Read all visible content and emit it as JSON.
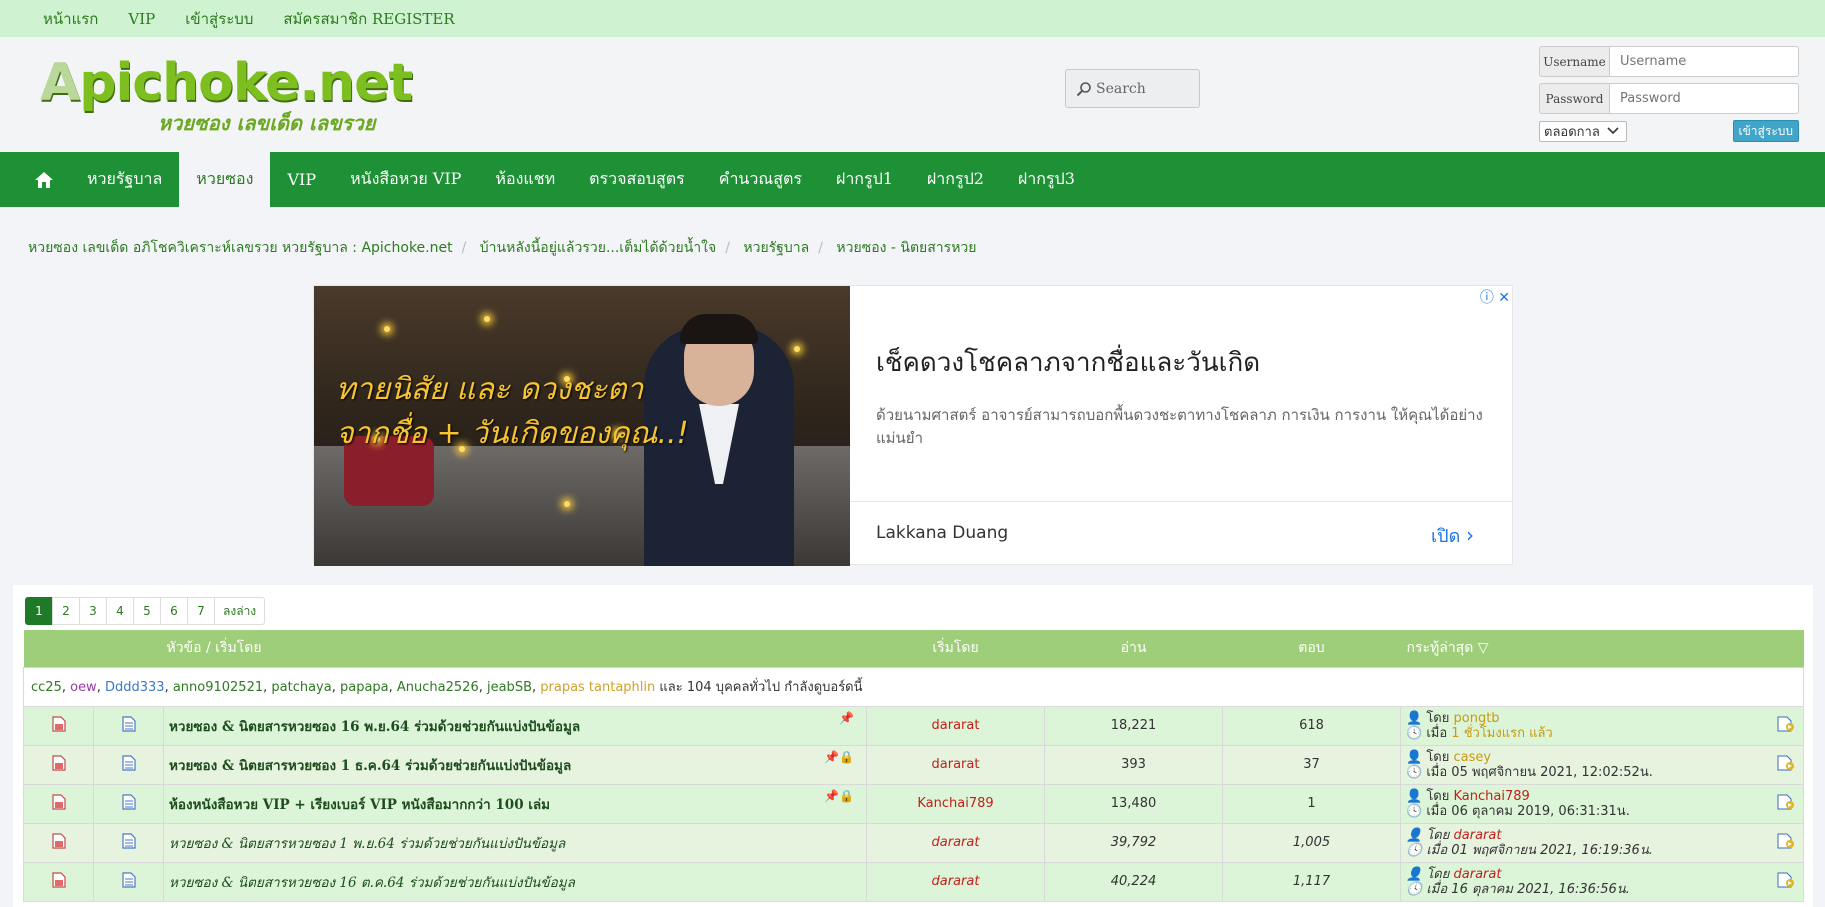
{
  "topbar": {
    "items": [
      "หน้าแรก",
      "VIP",
      "เข้าสู่ระบบ",
      "สมัครสมาชิก REGISTER"
    ]
  },
  "logo": {
    "main_a": "A",
    "main_rest": "pichoke.net",
    "sub": "หวยซอง เลขเด็ด เลขรวย"
  },
  "search": {
    "placeholder": "Search"
  },
  "login": {
    "username_label": "Username",
    "username_placeholder": "Username",
    "password_label": "Password",
    "password_placeholder": "Password",
    "period": "ตลอดกาล",
    "submit": "เข้าสู่ระบบ"
  },
  "nav": {
    "items": [
      "หวยรัฐบาล",
      "หวยซอง",
      "VIP",
      "หนังสือหวย VIP",
      "ห้องแชท",
      "ตรวจสอบสูตร",
      "คำนวณสูตร",
      "ฝากรูป1",
      "ฝากรูป2",
      "ฝากรูป3"
    ],
    "active": "หวยซอง"
  },
  "breadcrumb": [
    "หวยซอง เลขเด็ด อภิโชควิเคราะห์เลขรวย หวยรัฐบาล : Apichoke.net",
    "บ้านหลังนี้อยู่แล้วรวย...เต็มได้ด้วยน้ำใจ",
    "หวยรัฐบาล",
    "หวยซอง - นิตยสารหวย"
  ],
  "ad": {
    "image_line1": "ทายนิสัย และ ดวงชะตา",
    "image_line2": "จากชื่อ + วันเกิดของคุณ..!",
    "title": "เช็คดวงโชคลาภจากชื่อและวันเกิด",
    "description": "ด้วยนามศาสตร์ อาจารย์สามารถบอกพื้นดวงชะตาทางโชคลาภ การเงิน การงาน ให้คุณได้อย่างแม่นยำ",
    "brand": "Lakkana Duang",
    "open": "เปิด"
  },
  "pager": {
    "pages": [
      "1",
      "2",
      "3",
      "4",
      "5",
      "6",
      "7"
    ],
    "current": "1",
    "last_label": "ลงล่าง"
  },
  "table": {
    "headers": {
      "topic": "หัวข้อ / เริ่มโดย",
      "starter": "เริ่มโดย",
      "views": "อ่าน",
      "replies": "ตอบ",
      "last": "กระทู้ล่าสุด"
    },
    "online": {
      "users": [
        "cc25",
        "oew",
        "Dddd333",
        "anno9102521",
        "patchaya",
        "papapa",
        "Anucha2526",
        "jeabSB",
        "prapas tantaphlin"
      ],
      "suffix": "และ 104 บุคคลทั่วไป กำลังดูบอร์ดนี้"
    },
    "by_label": "โดย",
    "when_label": "เมื่อ",
    "rows": [
      {
        "title": "หวยซอง & นิตยสารหวยซอง 16 พ.ย.64 ร่วมด้วยช่วยกันแบ่งปันข้อมูล",
        "starter": "dararat",
        "views": "18,221",
        "replies": "618",
        "last_user": "pongtb",
        "last_time": "1 ชั่วโมงแรก แล้ว",
        "pinned": true,
        "locked": false,
        "style": "bold"
      },
      {
        "title": "หวยซอง & นิตยสารหวยซอง 1 ธ.ค.64 ร่วมด้วยช่วยกันแบ่งปันข้อมูล",
        "starter": "dararat",
        "views": "393",
        "replies": "37",
        "last_user": "casey",
        "last_time": "05 พฤศจิกายน 2021, 12:02:52น.",
        "pinned": true,
        "locked": true,
        "style": "bold"
      },
      {
        "title": "ห้องหนังสือหวย VIP + เรียงเบอร์ VIP หนังสือมากกว่า 100 เล่ม",
        "starter": "Kanchai789",
        "views": "13,480",
        "replies": "1",
        "last_user": "Kanchai789",
        "last_time": "06 ตุลาคม 2019, 06:31:31น.",
        "pinned": true,
        "locked": true,
        "style": "bold"
      },
      {
        "title": "หวยซอง & นิตยสารหวยซอง 1 พ.ย.64 ร่วมด้วยช่วยกันแบ่งปันข้อมูล",
        "starter": "dararat",
        "views": "39,792",
        "replies": "1,005",
        "last_user": "dararat",
        "last_time": "01 พฤศจิกายน 2021, 16:19:36น.",
        "pinned": false,
        "locked": false,
        "style": "italic"
      },
      {
        "title": "หวยซอง & นิตยสารหวยซอง 16 ต.ค.64 ร่วมด้วยช่วยกันแบ่งปันข้อมูล",
        "starter": "dararat",
        "views": "40,224",
        "replies": "1,117",
        "last_user": "dararat",
        "last_time": "16 ตุลาคม 2021, 16:36:56น.",
        "pinned": false,
        "locked": false,
        "style": "italic"
      }
    ]
  },
  "colors": {
    "nav_green": "#1e9035",
    "topbar": "#cff3d0",
    "header_row": "#9fce7a",
    "row_green": "#dcf4d7",
    "starter_red": "#c2211b"
  }
}
